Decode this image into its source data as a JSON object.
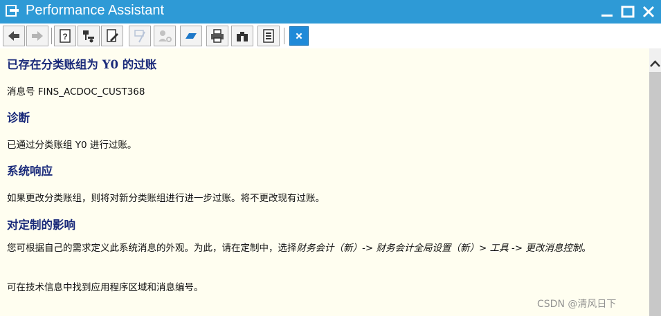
{
  "window": {
    "title": "Performance Assistant"
  },
  "toolbar": {
    "buttons": [
      {
        "icon": "back-arrow-icon",
        "enabled": true
      },
      {
        "icon": "forward-arrow-icon",
        "enabled": false
      },
      {
        "icon": "help-book-icon",
        "enabled": true
      },
      {
        "icon": "technical-info-icon",
        "enabled": true
      },
      {
        "icon": "edit-document-icon",
        "enabled": true
      },
      {
        "icon": "wand-icon",
        "enabled": false
      },
      {
        "icon": "user-key-icon",
        "enabled": false
      },
      {
        "icon": "bookmark-icon",
        "enabled": true
      },
      {
        "icon": "print-icon",
        "enabled": true
      },
      {
        "icon": "find-binoculars-icon",
        "enabled": true
      },
      {
        "icon": "document-list-icon",
        "enabled": true
      },
      {
        "icon": "close-x-icon",
        "enabled": true
      }
    ]
  },
  "message": {
    "title": "已存在分类账组为 Y0 的过账",
    "number_line": "消息号 FINS_ACDOC_CUST368",
    "diagnosis_heading": "诊断",
    "diagnosis_text": "已通过分类账组 Y0 进行过账。",
    "response_heading": "系统响应",
    "response_text": "如果更改分类账组，则将对新分类账组进行进一步过账。将不更改现有过账。",
    "customizing_heading": "对定制的影响",
    "customizing_text_prefix": "您可根据自己的需求定义此系统消息的外观。为此，请在定制中，选择",
    "customizing_path": "财务会计（新）-> 财务会计全局设置（新）> 工具 -> 更改消息控制",
    "customizing_text_suffix": "。",
    "technical_info_text": "可在技术信息中找到应用程序区域和消息编号。"
  },
  "watermark": "CSDN @清风日下",
  "colors": {
    "titlebar": "#2e9ad6",
    "content_background": "#fffef0",
    "heading": "#1a2a7a"
  }
}
